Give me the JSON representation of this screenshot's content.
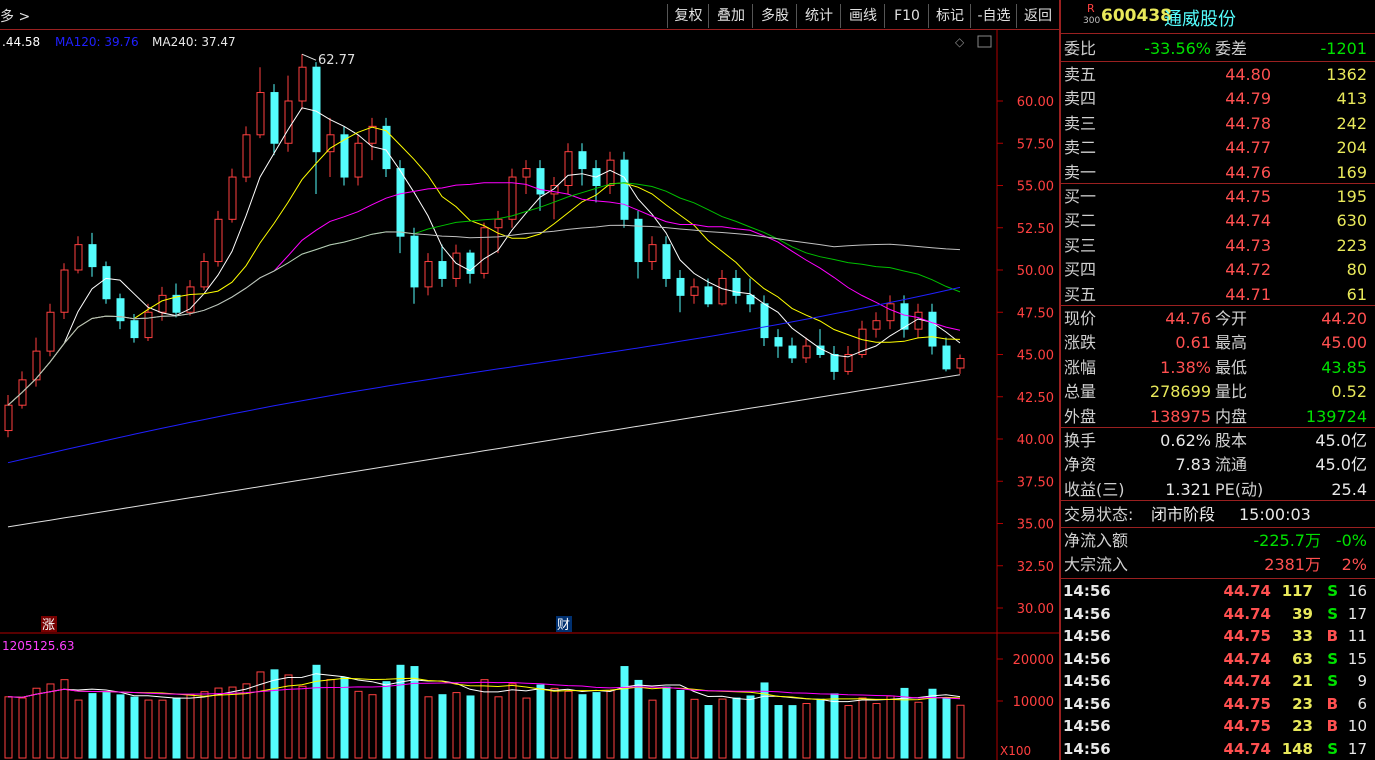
{
  "toolbar": {
    "left_label": "多 >",
    "buttons": [
      "复权",
      "叠加",
      "多股",
      "统计",
      "画线",
      "F10",
      "标记",
      "-自选",
      "返回"
    ]
  },
  "ma_legend": {
    "ma_prev": ".44.58",
    "ma120": "MA120: 39.76",
    "ma240": "MA240: 37.47"
  },
  "price_axis": [
    "60.00",
    "57.50",
    "55.00",
    "52.50",
    "50.00",
    "47.50",
    "45.00",
    "42.50",
    "40.00",
    "37.50",
    "35.00",
    "32.50",
    "30.00"
  ],
  "volume_axis": [
    "20000",
    "10000"
  ],
  "volume_unit": "X100",
  "peak_label": "62.77",
  "marks": {
    "zhang": "涨",
    "cai": "财"
  },
  "volume_legend": "1205125.63",
  "colors": {
    "up": "#ff4040",
    "down": "#54fcfc",
    "ma5": "#ffffff",
    "ma10": "#ffff00",
    "ma20": "#ff00ff",
    "ma30": "#00c000",
    "ma60": "#c0c0c0",
    "ma120": "#2020ff",
    "ma240": "#e0e0e0",
    "axis": "#b00000"
  },
  "stock": {
    "badge_top": "R",
    "badge_bottom": "300",
    "code": "600438",
    "name": "通威股份"
  },
  "weibi": {
    "label": "委比",
    "value": "-33.56%",
    "diff_label": "委差",
    "diff_value": "-1201"
  },
  "asks": [
    {
      "label": "卖五",
      "price": "44.80",
      "vol": "1362"
    },
    {
      "label": "卖四",
      "price": "44.79",
      "vol": "413"
    },
    {
      "label": "卖三",
      "price": "44.78",
      "vol": "242"
    },
    {
      "label": "卖二",
      "price": "44.77",
      "vol": "204"
    },
    {
      "label": "卖一",
      "price": "44.76",
      "vol": "169"
    }
  ],
  "bids": [
    {
      "label": "买一",
      "price": "44.75",
      "vol": "195"
    },
    {
      "label": "买二",
      "price": "44.74",
      "vol": "630"
    },
    {
      "label": "买三",
      "price": "44.73",
      "vol": "223"
    },
    {
      "label": "买四",
      "price": "44.72",
      "vol": "80"
    },
    {
      "label": "买五",
      "price": "44.71",
      "vol": "61"
    }
  ],
  "quote": [
    {
      "l1": "现价",
      "v1": "44.76",
      "l2": "今开",
      "v2": "44.20"
    },
    {
      "l1": "涨跌",
      "v1": "0.61",
      "l2": "最高",
      "v2": "45.00"
    },
    {
      "l1": "涨幅",
      "v1": "1.38%",
      "l2": "最低",
      "v2": "43.85"
    },
    {
      "l1": "总量",
      "v1": "278699",
      "l2": "量比",
      "v2": "0.52"
    },
    {
      "l1": "外盘",
      "v1": "138975",
      "l2": "内盘",
      "v2": "139724"
    }
  ],
  "fundamentals": [
    {
      "l1": "换手",
      "v1": "0.62%",
      "l2": "股本",
      "v2": "45.0亿"
    },
    {
      "l1": "净资",
      "v1": "7.83",
      "l2": "流通",
      "v2": "45.0亿"
    },
    {
      "l1": "收益(三)",
      "v1": "1.321",
      "l2": "PE(动)",
      "v2": "25.4"
    }
  ],
  "status": {
    "label": "交易状态:",
    "value": "闭市阶段",
    "time": "15:00:03"
  },
  "flows": [
    {
      "label": "净流入额",
      "value": "-225.7万",
      "pct": "-0%"
    },
    {
      "label": "大宗流入",
      "value": "2381万",
      "pct": "2%"
    }
  ],
  "trades": [
    {
      "time": "14:56",
      "price": "44.74",
      "vol": "117",
      "side": "S",
      "n": "16"
    },
    {
      "time": "14:56",
      "price": "44.74",
      "vol": "39",
      "side": "S",
      "n": "17"
    },
    {
      "time": "14:56",
      "price": "44.75",
      "vol": "33",
      "side": "B",
      "n": "11"
    },
    {
      "time": "14:56",
      "price": "44.74",
      "vol": "63",
      "side": "S",
      "n": "15"
    },
    {
      "time": "14:56",
      "price": "44.74",
      "vol": "21",
      "side": "S",
      "n": "9"
    },
    {
      "time": "14:56",
      "price": "44.75",
      "vol": "23",
      "side": "B",
      "n": "6"
    },
    {
      "time": "14:56",
      "price": "44.75",
      "vol": "23",
      "side": "B",
      "n": "10"
    },
    {
      "time": "14:56",
      "price": "44.74",
      "vol": "148",
      "side": "S",
      "n": "17"
    }
  ],
  "chart_data": {
    "type": "candlestick",
    "price_ylim": [
      30.0,
      62.77
    ],
    "volume_ylim": [
      0,
      20000
    ],
    "candles_approx": [
      {
        "o": 40.5,
        "c": 42.0,
        "h": 42.6,
        "l": 40.1
      },
      {
        "o": 42.0,
        "c": 43.5,
        "h": 44.0,
        "l": 41.8
      },
      {
        "o": 43.5,
        "c": 45.2,
        "h": 46.0,
        "l": 43.1
      },
      {
        "o": 45.2,
        "c": 47.5,
        "h": 48.0,
        "l": 44.9
      },
      {
        "o": 47.5,
        "c": 50.0,
        "h": 50.4,
        "l": 47.1
      },
      {
        "o": 50.0,
        "c": 51.5,
        "h": 52.0,
        "l": 49.8
      },
      {
        "o": 51.5,
        "c": 50.2,
        "h": 52.2,
        "l": 49.6
      },
      {
        "o": 50.2,
        "c": 48.3,
        "h": 50.5,
        "l": 48.0
      },
      {
        "o": 48.3,
        "c": 47.0,
        "h": 48.6,
        "l": 46.5
      },
      {
        "o": 47.0,
        "c": 46.0,
        "h": 47.4,
        "l": 45.7
      },
      {
        "o": 46.0,
        "c": 47.5,
        "h": 48.0,
        "l": 45.8
      },
      {
        "o": 47.5,
        "c": 48.5,
        "h": 49.0,
        "l": 47.0
      },
      {
        "o": 48.5,
        "c": 47.5,
        "h": 49.2,
        "l": 47.2
      },
      {
        "o": 47.5,
        "c": 49.0,
        "h": 49.4,
        "l": 47.3
      },
      {
        "o": 49.0,
        "c": 50.5,
        "h": 51.0,
        "l": 48.8
      },
      {
        "o": 50.5,
        "c": 53.0,
        "h": 53.5,
        "l": 50.2
      },
      {
        "o": 53.0,
        "c": 55.5,
        "h": 56.0,
        "l": 52.8
      },
      {
        "o": 55.5,
        "c": 58.0,
        "h": 58.5,
        "l": 55.2
      },
      {
        "o": 58.0,
        "c": 60.5,
        "h": 62.0,
        "l": 57.8
      },
      {
        "o": 60.5,
        "c": 57.5,
        "h": 61.0,
        "l": 56.8
      },
      {
        "o": 57.5,
        "c": 60.0,
        "h": 61.5,
        "l": 57.0
      },
      {
        "o": 60.0,
        "c": 62.0,
        "h": 62.77,
        "l": 59.5
      },
      {
        "o": 62.0,
        "c": 57.0,
        "h": 62.3,
        "l": 54.5
      },
      {
        "o": 57.0,
        "c": 58.0,
        "h": 59.0,
        "l": 55.5
      },
      {
        "o": 58.0,
        "c": 55.5,
        "h": 58.5,
        "l": 55.0
      },
      {
        "o": 55.5,
        "c": 57.5,
        "h": 58.0,
        "l": 55.0
      },
      {
        "o": 57.5,
        "c": 58.5,
        "h": 59.0,
        "l": 56.5
      },
      {
        "o": 58.5,
        "c": 56.0,
        "h": 59.0,
        "l": 55.5
      },
      {
        "o": 56.0,
        "c": 52.0,
        "h": 56.5,
        "l": 51.0
      },
      {
        "o": 52.0,
        "c": 49.0,
        "h": 52.5,
        "l": 48.0
      },
      {
        "o": 49.0,
        "c": 50.5,
        "h": 51.0,
        "l": 48.5
      },
      {
        "o": 50.5,
        "c": 49.5,
        "h": 51.5,
        "l": 49.0
      },
      {
        "o": 49.5,
        "c": 51.0,
        "h": 51.5,
        "l": 49.0
      },
      {
        "o": 51.0,
        "c": 49.8,
        "h": 51.2,
        "l": 49.2
      },
      {
        "o": 49.8,
        "c": 52.5,
        "h": 52.8,
        "l": 49.5
      },
      {
        "o": 52.5,
        "c": 53.0,
        "h": 53.5,
        "l": 51.0
      },
      {
        "o": 53.0,
        "c": 55.5,
        "h": 56.0,
        "l": 52.5
      },
      {
        "o": 55.5,
        "c": 56.0,
        "h": 56.5,
        "l": 54.5
      },
      {
        "o": 56.0,
        "c": 54.5,
        "h": 56.5,
        "l": 53.5
      },
      {
        "o": 54.5,
        "c": 55.0,
        "h": 55.5,
        "l": 53.0
      },
      {
        "o": 55.0,
        "c": 57.0,
        "h": 57.5,
        "l": 54.5
      },
      {
        "o": 57.0,
        "c": 56.0,
        "h": 57.5,
        "l": 55.0
      },
      {
        "o": 56.0,
        "c": 55.0,
        "h": 56.5,
        "l": 54.0
      },
      {
        "o": 55.0,
        "c": 56.5,
        "h": 57.0,
        "l": 54.5
      },
      {
        "o": 56.5,
        "c": 53.0,
        "h": 57.0,
        "l": 52.5
      },
      {
        "o": 53.0,
        "c": 50.5,
        "h": 53.5,
        "l": 49.5
      },
      {
        "o": 50.5,
        "c": 51.5,
        "h": 52.0,
        "l": 50.0
      },
      {
        "o": 51.5,
        "c": 49.5,
        "h": 52.0,
        "l": 49.0
      },
      {
        "o": 49.5,
        "c": 48.5,
        "h": 50.0,
        "l": 47.5
      },
      {
        "o": 48.5,
        "c": 49.0,
        "h": 49.5,
        "l": 48.0
      },
      {
        "o": 49.0,
        "c": 48.0,
        "h": 49.5,
        "l": 47.8
      },
      {
        "o": 48.0,
        "c": 49.5,
        "h": 50.0,
        "l": 47.9
      },
      {
        "o": 49.5,
        "c": 48.5,
        "h": 50.0,
        "l": 48.0
      },
      {
        "o": 48.5,
        "c": 48.0,
        "h": 49.5,
        "l": 47.5
      },
      {
        "o": 48.0,
        "c": 46.0,
        "h": 48.5,
        "l": 45.5
      },
      {
        "o": 46.0,
        "c": 45.5,
        "h": 46.5,
        "l": 44.8
      },
      {
        "o": 45.5,
        "c": 44.8,
        "h": 46.0,
        "l": 44.5
      },
      {
        "o": 44.8,
        "c": 45.5,
        "h": 46.0,
        "l": 44.5
      },
      {
        "o": 45.5,
        "c": 45.0,
        "h": 46.5,
        "l": 44.8
      },
      {
        "o": 45.0,
        "c": 44.0,
        "h": 45.5,
        "l": 43.5
      },
      {
        "o": 44.0,
        "c": 45.0,
        "h": 45.5,
        "l": 43.8
      },
      {
        "o": 45.0,
        "c": 46.5,
        "h": 47.0,
        "l": 44.8
      },
      {
        "o": 46.5,
        "c": 47.0,
        "h": 47.5,
        "l": 46.0
      },
      {
        "o": 47.0,
        "c": 48.0,
        "h": 48.5,
        "l": 46.5
      },
      {
        "o": 48.0,
        "c": 46.5,
        "h": 48.5,
        "l": 46.0
      },
      {
        "o": 46.5,
        "c": 47.5,
        "h": 48.0,
        "l": 46.0
      },
      {
        "o": 47.5,
        "c": 45.5,
        "h": 48.0,
        "l": 45.0
      },
      {
        "o": 45.5,
        "c": 44.15,
        "h": 46.0,
        "l": 44.0
      },
      {
        "o": 44.2,
        "c": 44.76,
        "h": 45.0,
        "l": 43.85
      }
    ]
  }
}
